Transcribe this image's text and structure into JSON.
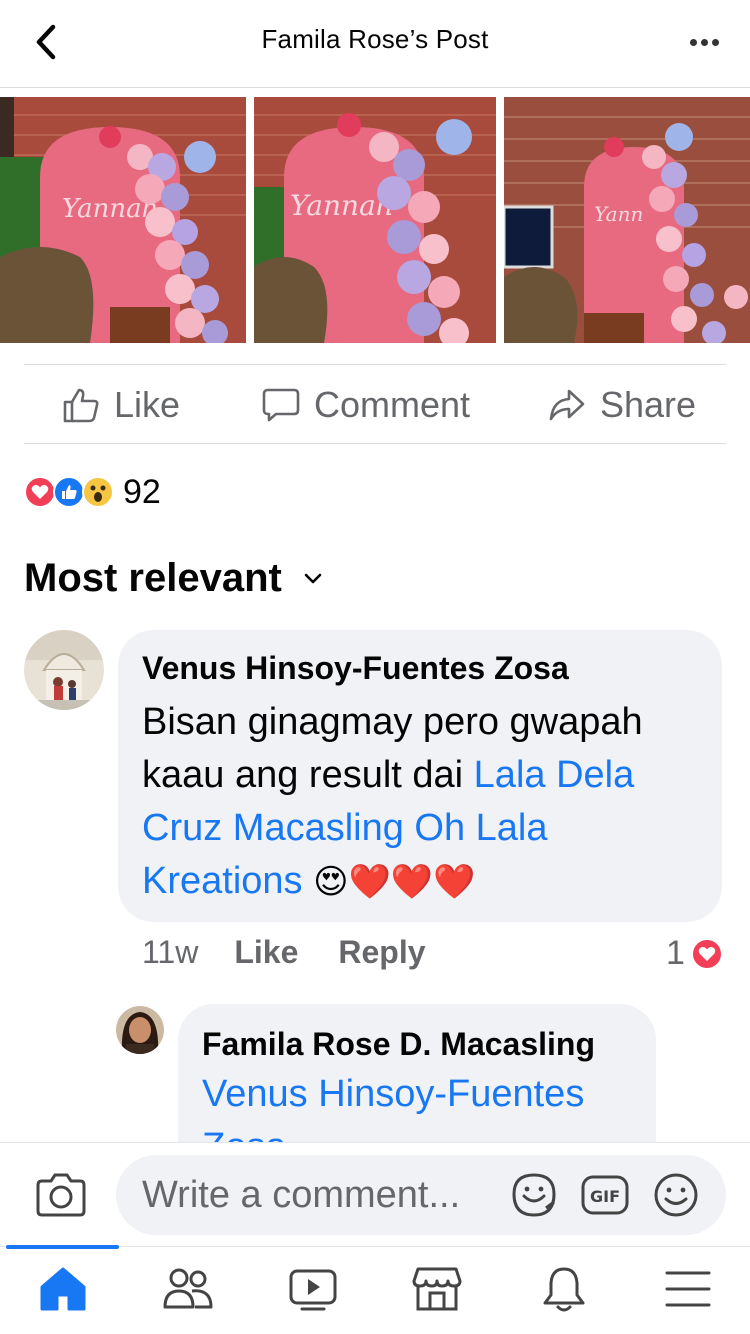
{
  "header": {
    "title": "Famila Rose’s Post"
  },
  "actions": {
    "like": "Like",
    "comment": "Comment",
    "share": "Share"
  },
  "reactions": {
    "count": "92",
    "types": [
      "love-icon",
      "like-icon",
      "wow-icon"
    ]
  },
  "sort": {
    "label": "Most relevant"
  },
  "comments": [
    {
      "author": "Venus Hinsoy-Fuentes Zosa",
      "text_plain": "Bisan ginagmay pero gwapah kaau ang result dai ",
      "mention": "Lala Dela Cruz Macasling Oh Lala Kreations",
      "emoji": "😍❤️❤️❤️",
      "time": "11w",
      "like_label": "Like",
      "reply_label": "Reply",
      "reaction_count": "1"
    },
    {
      "author": "Famila Rose D. Macasling",
      "mention": "Venus Hinsoy-Fuentes Zosa"
    }
  ],
  "composer": {
    "placeholder": "Write a comment..."
  },
  "bottom_nav": {
    "items": [
      "home-icon",
      "friends-icon",
      "watch-icon",
      "marketplace-icon",
      "notifications-icon",
      "menu-icon"
    ],
    "active": "home-icon"
  },
  "colors": {
    "accent": "#1877f2",
    "bubble": "#f0f2f5",
    "muted": "#65676b",
    "love": "#f33e58"
  }
}
